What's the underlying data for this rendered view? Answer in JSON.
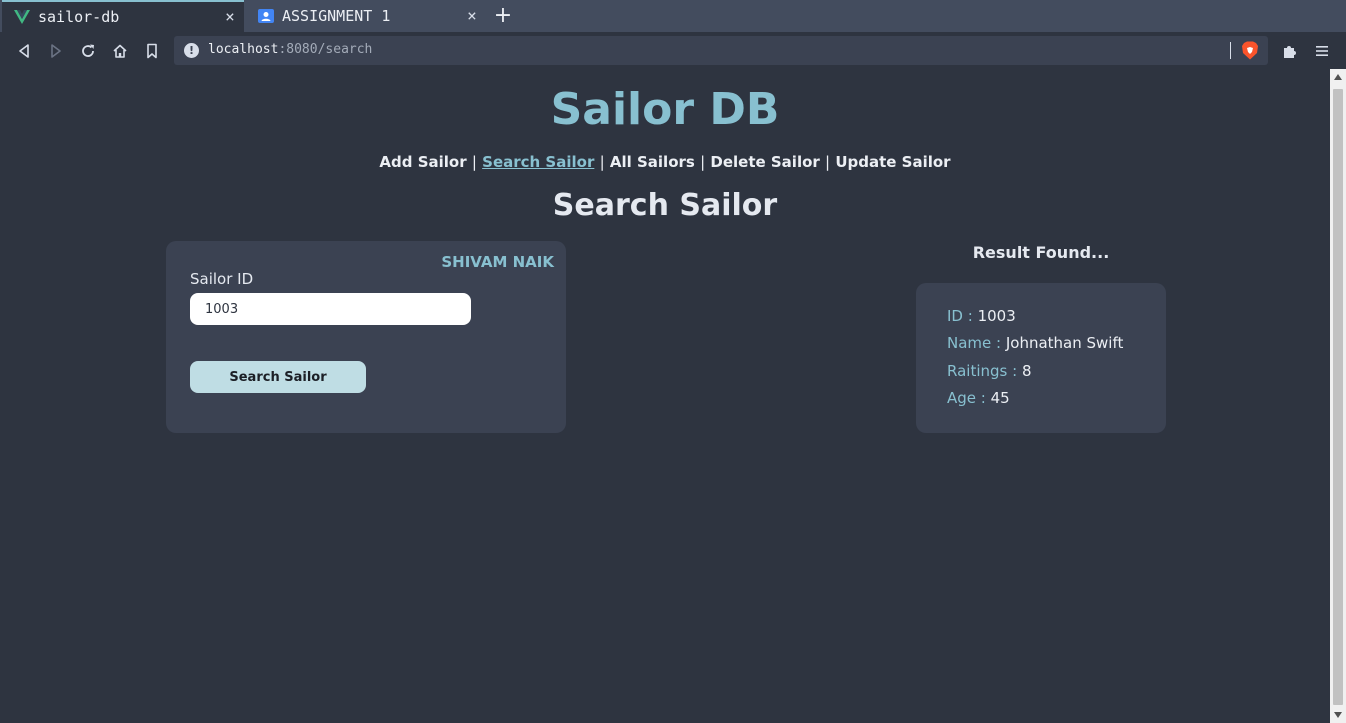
{
  "browser": {
    "tabs": [
      {
        "title": "sailor-db",
        "active": true,
        "icon": "vue-logo-icon"
      },
      {
        "title": "ASSIGNMENT 1",
        "active": false,
        "icon": "contacts-icon"
      }
    ],
    "url_host": "localhost",
    "url_rest": ":8080/search",
    "accent": "#88c0d0"
  },
  "app": {
    "title": "Sailor DB",
    "nav": {
      "add": "Add Sailor",
      "search": "Search Sailor",
      "all": "All Sailors",
      "delete": "Delete Sailor",
      "update": "Update Sailor",
      "separator": "|"
    },
    "section_title": "Search Sailor"
  },
  "search": {
    "owner": "SHIVAM NAIK",
    "field_label": "Sailor ID",
    "field_value": "1003",
    "button": "Search Sailor"
  },
  "result": {
    "heading": "Result Found...",
    "rows": [
      {
        "key": "ID :",
        "value": "1003"
      },
      {
        "key": "Name :",
        "value": "Johnathan Swift"
      },
      {
        "key": "Raitings :",
        "value": "8"
      },
      {
        "key": "Age :",
        "value": "45"
      }
    ]
  },
  "colors": {
    "background": "#2e3440",
    "card": "#3b4252",
    "accent": "#88c0d0",
    "button": "#bfdde4"
  }
}
